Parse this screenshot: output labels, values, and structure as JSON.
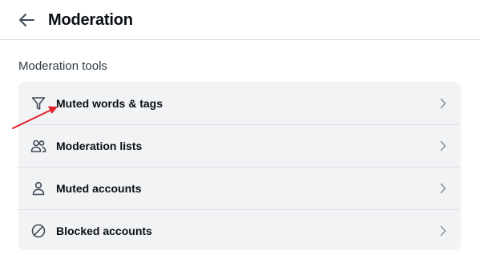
{
  "header": {
    "title": "Moderation",
    "back_icon": "arrow-left-icon"
  },
  "section": {
    "title": "Moderation tools"
  },
  "items": [
    {
      "label": "Muted words & tags",
      "icon": "filter-icon"
    },
    {
      "label": "Moderation lists",
      "icon": "users-icon"
    },
    {
      "label": "Muted accounts",
      "icon": "person-icon"
    },
    {
      "label": "Blocked accounts",
      "icon": "blocked-icon"
    }
  ],
  "colors": {
    "card_bg": "#f1f3f5",
    "annotation_arrow": "#e0202a",
    "chevron": "#8a949e"
  }
}
